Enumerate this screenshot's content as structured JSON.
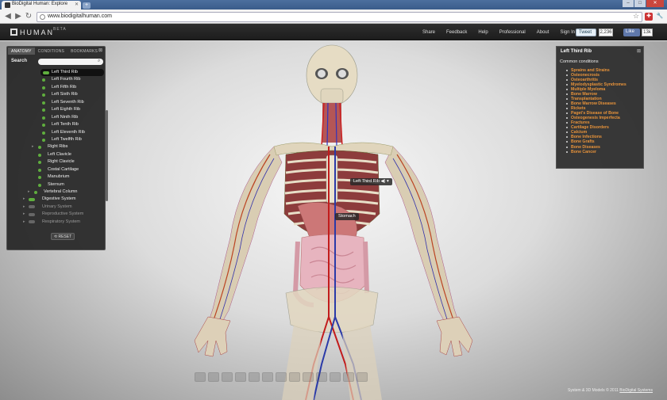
{
  "browser": {
    "tab_title": "BioDigital Human: Explore",
    "url": "www.biodigitalhuman.com"
  },
  "header": {
    "logo_text": "HUMAN",
    "beta_label": "BETA",
    "nav": [
      "Share",
      "Feedback",
      "Help",
      "Professional",
      "About",
      "Sign In"
    ],
    "tweet_label": "Tweet",
    "tweet_count": "2,236",
    "like_label": "Like",
    "like_count": "13k"
  },
  "left_panel": {
    "tabs": [
      "ANATOMY",
      "CONDITIONS",
      "BOOKMARKS"
    ],
    "search_label": "Search",
    "tree": [
      {
        "label": "Left Third Rib",
        "state": "selected"
      },
      {
        "label": "Left Fourth Rib",
        "state": "on"
      },
      {
        "label": "Left Fifth Rib",
        "state": "on"
      },
      {
        "label": "Left Sixth Rib",
        "state": "on"
      },
      {
        "label": "Left Seventh Rib",
        "state": "on"
      },
      {
        "label": "Left Eighth Rib",
        "state": "on"
      },
      {
        "label": "Left Ninth Rib",
        "state": "on"
      },
      {
        "label": "Left Tenth Rib",
        "state": "on"
      },
      {
        "label": "Left Eleventh Rib",
        "state": "on"
      },
      {
        "label": "Left Twelfth Rib",
        "state": "on"
      },
      {
        "label": "Right Ribs",
        "state": "group"
      },
      {
        "label": "Left Clavicle",
        "state": "group"
      },
      {
        "label": "Right Clavicle",
        "state": "group"
      },
      {
        "label": "Costal Cartilage",
        "state": "group"
      },
      {
        "label": "Manubrium",
        "state": "group"
      },
      {
        "label": "Sternum",
        "state": "group"
      },
      {
        "label": "Vertebral Column",
        "state": "parent"
      },
      {
        "label": "Digestive System",
        "state": "system-on"
      },
      {
        "label": "Urinary System",
        "state": "system-off"
      },
      {
        "label": "Reproductive System",
        "state": "system-off"
      },
      {
        "label": "Respiratory System",
        "state": "system-off"
      }
    ],
    "reset_label": "RESET"
  },
  "right_panel": {
    "title": "Left Third Rib",
    "subtitle": "Common conditions",
    "conditions": [
      "Sprains and Strains",
      "Osteonecrosis",
      "Osteoarthritis",
      "Myelodysplastic Syndromes",
      "Multiple Myeloma",
      "Bone Marrow",
      "Transplantation",
      "Bone Marrow Diseases",
      "Rickets",
      "Paget's Disease of Bone",
      "Osteogenesis Imperfecta",
      "Fractures",
      "Cartilage Disorders",
      "Calcium",
      "Bone Infections",
      "Bone Grafts",
      "Bone Diseases",
      "Bone Cancer"
    ]
  },
  "body_labels": {
    "rib_tag": "Left Third Rib",
    "stomach_tag": "Stomach"
  },
  "footer": {
    "text": "System & 3D Models © 2011",
    "link": "BioDigital Systems"
  }
}
